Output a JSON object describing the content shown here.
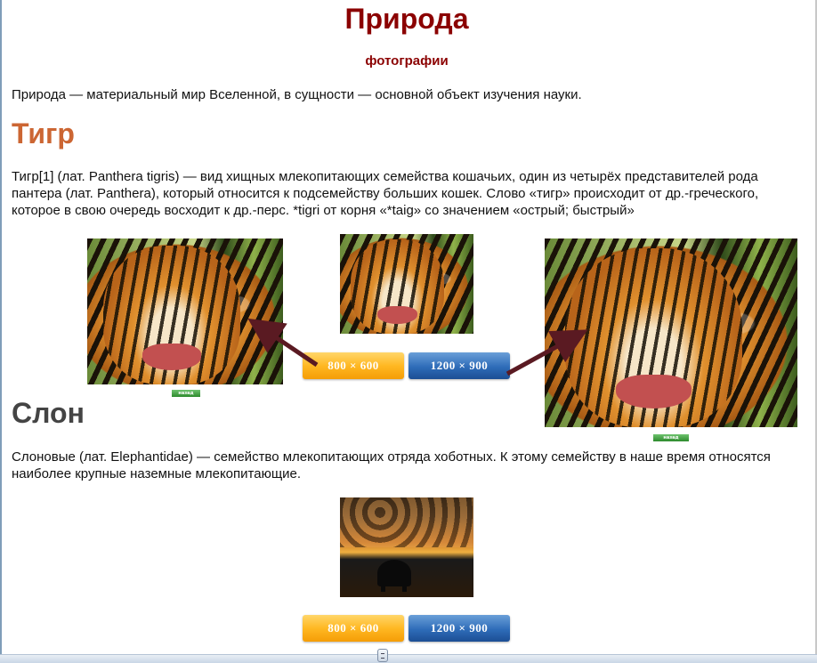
{
  "page": {
    "title": "Природа",
    "subtitle": "фотографии",
    "intro": "Природа — материальный мир Вселенной, в сущности — основной объект изучения науки."
  },
  "tiger": {
    "heading": "Тигр",
    "text": "Тигр[1] (лат. Panthera tigris) — вид хищных млекопитающих семейства кошачьих, один из четырёх представителей рода пантера (лат. Panthera), который относится к подсемейству больших кошек. Слово «тигр» происходит от др.-греческого, которое в свою очередь восходит к др.-перс. *tigri от корня «*taig» со значением «острый; быстрый»",
    "button_800": "800 × 600",
    "button_1200": "1200 × 900",
    "back_label": "назад"
  },
  "elephant": {
    "heading": "Слон",
    "text": "Слоновые (лат. Elephantidae) — семейство млекопитающих отряда хоботных. К этому семейству в наше время относятся наиболее крупные наземные млекопитающие.",
    "button_800": "800 × 600",
    "button_1200": "1200 × 900"
  },
  "colors": {
    "title": "#8b0000",
    "tiger_heading": "#cc6633",
    "elephant_heading": "#444444",
    "orange_button": "#ffb823",
    "blue_button": "#2e6cb8",
    "arrow": "#5a1a22"
  }
}
